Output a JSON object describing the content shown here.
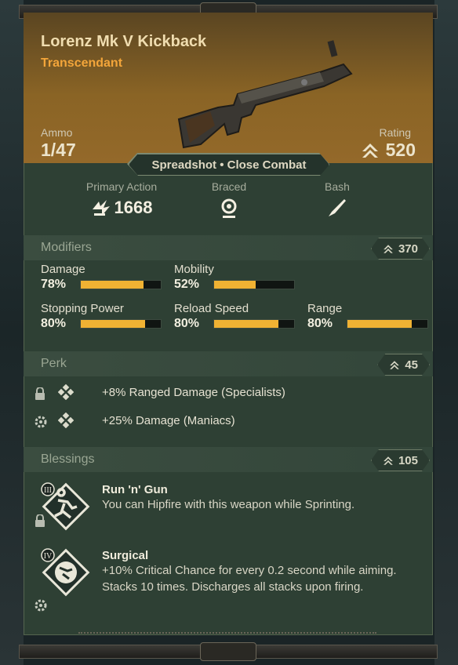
{
  "weapon": {
    "name": "Lorenz Mk V Kickback",
    "rarity": "Transcendant",
    "ammo_label": "Ammo",
    "ammo_value": "1/47",
    "rating_label": "Rating",
    "rating_value": "520",
    "tags": "Spreadshot • Close Combat"
  },
  "actions": [
    {
      "label": "Primary Action",
      "value": "1668",
      "icon": "damage-burst-icon"
    },
    {
      "label": "Braced",
      "value": "",
      "icon": "crosshair-icon"
    },
    {
      "label": "Bash",
      "value": "",
      "icon": "blade-icon"
    }
  ],
  "modifiers": {
    "title": "Modifiers",
    "rating": "370",
    "items": [
      {
        "label": "Damage",
        "value": "78%",
        "fill": 0.78
      },
      {
        "label": "Mobility",
        "value": "52%",
        "fill": 0.52
      },
      {
        "label": "Stopping Power",
        "value": "80%",
        "fill": 0.8
      },
      {
        "label": "Reload Speed",
        "value": "80%",
        "fill": 0.8
      },
      {
        "label": "Range",
        "value": "80%",
        "fill": 0.8
      }
    ]
  },
  "perks": {
    "title": "Perk",
    "rating": "45",
    "items": [
      {
        "text": "+8% Ranged Damage (Specialists)",
        "status_icon": "lock-icon"
      },
      {
        "text": "+25%  Damage (Maniacs)",
        "status_icon": "gear-icon"
      }
    ]
  },
  "blessings": {
    "title": "Blessings",
    "rating": "105",
    "items": [
      {
        "name": "Run 'n' Gun",
        "tier": "III",
        "desc": "You can Hipfire with this weapon while Sprinting.",
        "status_icon": "lock-icon"
      },
      {
        "name": "Surgical",
        "tier": "IV",
        "desc": "+10% Critical Chance for every 0.2 second while aiming. Stacks 10 times. Discharges all stacks upon firing.",
        "status_icon": "gear-icon"
      }
    ]
  },
  "colors": {
    "accent": "#f0b233",
    "rarity": "#f3a53a",
    "panel": "#2e4034"
  }
}
